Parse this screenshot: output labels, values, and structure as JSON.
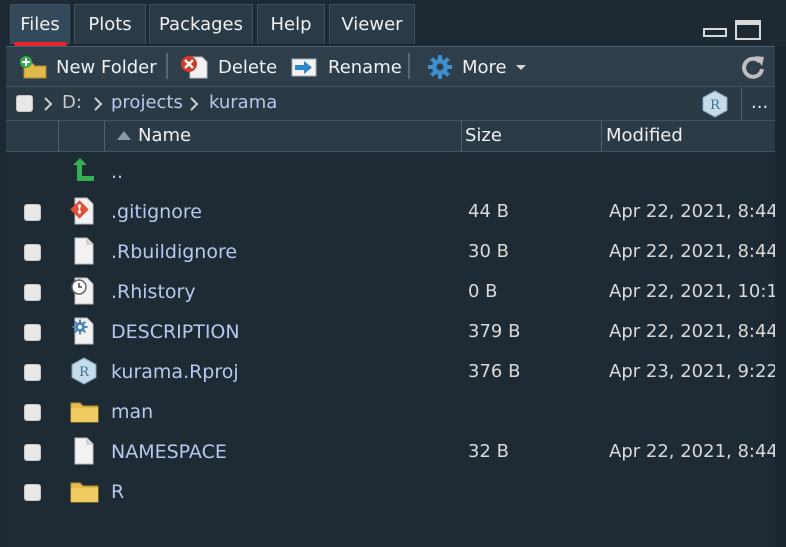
{
  "tabs": [
    {
      "label": "Files",
      "active": true
    },
    {
      "label": "Plots",
      "active": false
    },
    {
      "label": "Packages",
      "active": false
    },
    {
      "label": "Help",
      "active": false
    },
    {
      "label": "Viewer",
      "active": false
    }
  ],
  "toolbar": {
    "new_folder": "New Folder",
    "delete": "Delete",
    "rename": "Rename",
    "more": "More"
  },
  "path": {
    "crumbs": [
      "D:",
      "projects",
      "kurama"
    ],
    "more": "..."
  },
  "header": {
    "name": "Name",
    "size": "Size",
    "modified": "Modified"
  },
  "files": [
    {
      "name": "..",
      "size": "",
      "modified": "",
      "icon": "parent-dir-icon"
    },
    {
      "name": ".gitignore",
      "size": "44 B",
      "modified": "Apr 22, 2021, 8:44",
      "icon": "git-file-icon"
    },
    {
      "name": ".Rbuildignore",
      "size": "30 B",
      "modified": "Apr 22, 2021, 8:44",
      "icon": "file-icon"
    },
    {
      "name": ".Rhistory",
      "size": "0 B",
      "modified": "Apr 22, 2021, 10:1",
      "icon": "history-file-icon"
    },
    {
      "name": "DESCRIPTION",
      "size": "379 B",
      "modified": "Apr 22, 2021, 8:44",
      "icon": "description-file-icon"
    },
    {
      "name": "kurama.Rproj",
      "size": "376 B",
      "modified": "Apr 23, 2021, 9:22",
      "icon": "rproj-file-icon"
    },
    {
      "name": "man",
      "size": "",
      "modified": "",
      "icon": "folder-icon"
    },
    {
      "name": "NAMESPACE",
      "size": "32 B",
      "modified": "Apr 22, 2021, 8:44",
      "icon": "file-icon"
    },
    {
      "name": "R",
      "size": "",
      "modified": "",
      "icon": "folder-icon"
    }
  ],
  "colors": {
    "accent_underline": "#e8252f",
    "file_link": "#b7c8ee",
    "background": "#1f2b34"
  }
}
